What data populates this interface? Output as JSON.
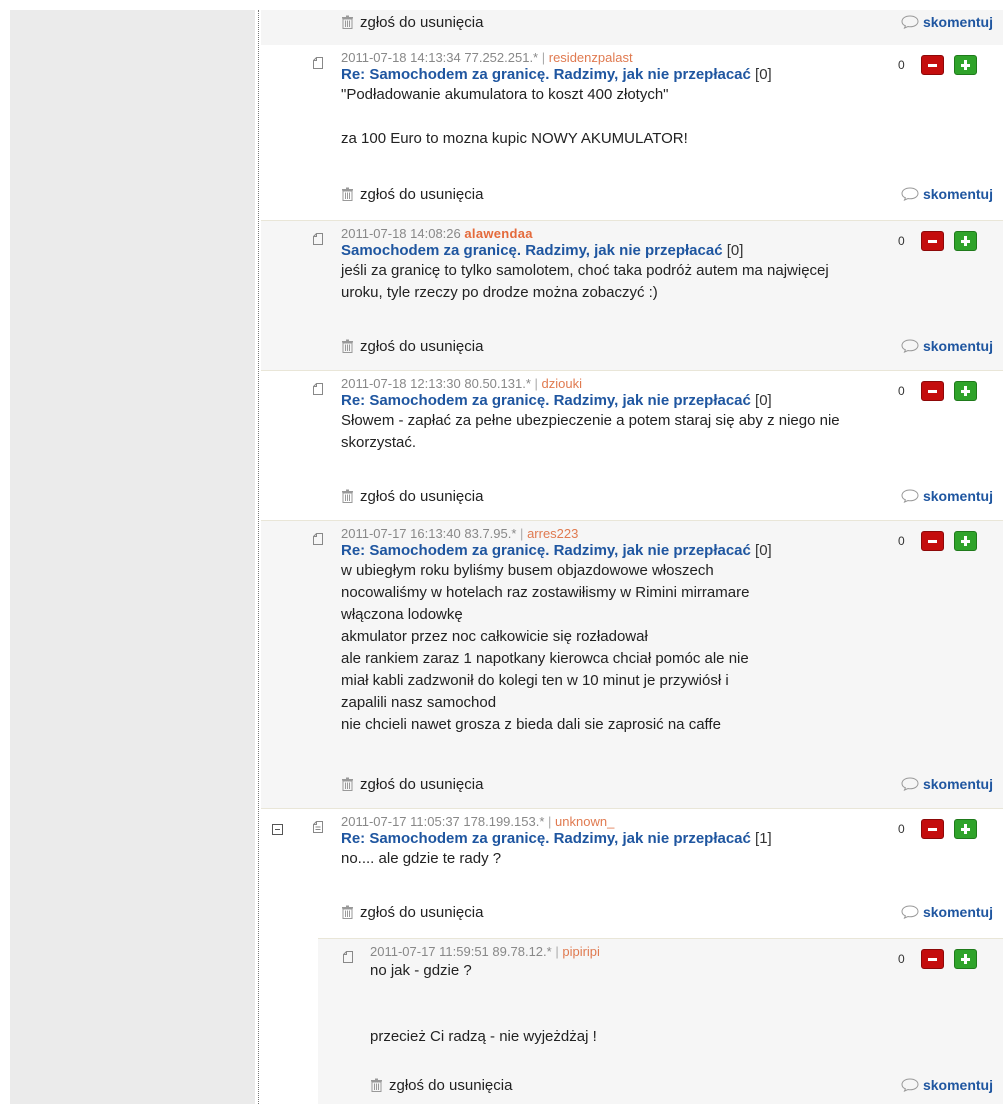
{
  "labels": {
    "report": "zgłoś do usunięcia",
    "reply": "skomentuj"
  },
  "comments": [
    {
      "date": "2011-07-18 14:13:34",
      "ip": "77.252.251.*",
      "sep": "|",
      "user": "residenzpalast",
      "title": "Re: Samochodem za granicę. Radzimy, jak nie przepłacać",
      "count": "[0]",
      "text": "\"Podładowanie akumulatora to koszt 400 złotych\"\n\nza 100 Euro to mozna kupic NOWY AKUMULATOR!",
      "score": "0"
    },
    {
      "date": "2011-07-18 14:08:26",
      "user": "alawendaa",
      "title": "Samochodem za granicę. Radzimy, jak nie przepłacać",
      "count": "[0]",
      "text": "jeśli za granicę to tylko samolotem, choć taka podróż autem ma najwięcej uroku, tyle rzeczy po drodze można zobaczyć :)",
      "score": "0"
    },
    {
      "date": "2011-07-18 12:13:30",
      "ip": "80.50.131.*",
      "sep": "|",
      "user": "dziouki",
      "title": "Re: Samochodem za granicę. Radzimy, jak nie przepłacać",
      "count": "[0]",
      "text": "Słowem - zapłać za pełne ubezpieczenie a potem staraj się aby z niego nie skorzystać.",
      "score": "0"
    },
    {
      "date": "2011-07-17 16:13:40",
      "ip": "83.7.95.*",
      "sep": "|",
      "user": "arres223",
      "title": "Re: Samochodem za granicę. Radzimy, jak nie przepłacać",
      "count": "[0]",
      "text": "w ubiegłym roku byliśmy busem objazdowowe włoszech\nnocowaliśmy w hotelach raz zostawiłismy w Rimini mirramare\nwłączona lodowkę\nakmulator przez noc całkowicie się rozładował\nale rankiem zaraz 1 napotkany kierowca chciał pomóc ale nie\nmiał kabli zadzwonił do kolegi ten w 10 minut je przywiósł i\nzapalili nasz samochod\nnie chcieli nawet grosza z bieda dali sie zaprosić na caffe",
      "score": "0"
    },
    {
      "date": "2011-07-17 11:05:37",
      "ip": "178.199.153.*",
      "sep": "|",
      "user": "unknown_",
      "title": "Re: Samochodem za granicę. Radzimy, jak nie przepłacać",
      "count": "[1]",
      "text": "no.... ale gdzie te rady ?",
      "score": "0"
    },
    {
      "date": "2011-07-17 11:59:51",
      "ip": "89.78.12.*",
      "sep": "|",
      "user": "pipiripi",
      "text": "no jak - gdzie ?\n\n\nprzecież Ci radzą - nie wyjeżdżaj !",
      "score": "0"
    }
  ],
  "colors": {
    "link": "#1f56a0",
    "username": "#e07a50",
    "minus": "#c40d0d",
    "plus": "#2fa32a"
  }
}
